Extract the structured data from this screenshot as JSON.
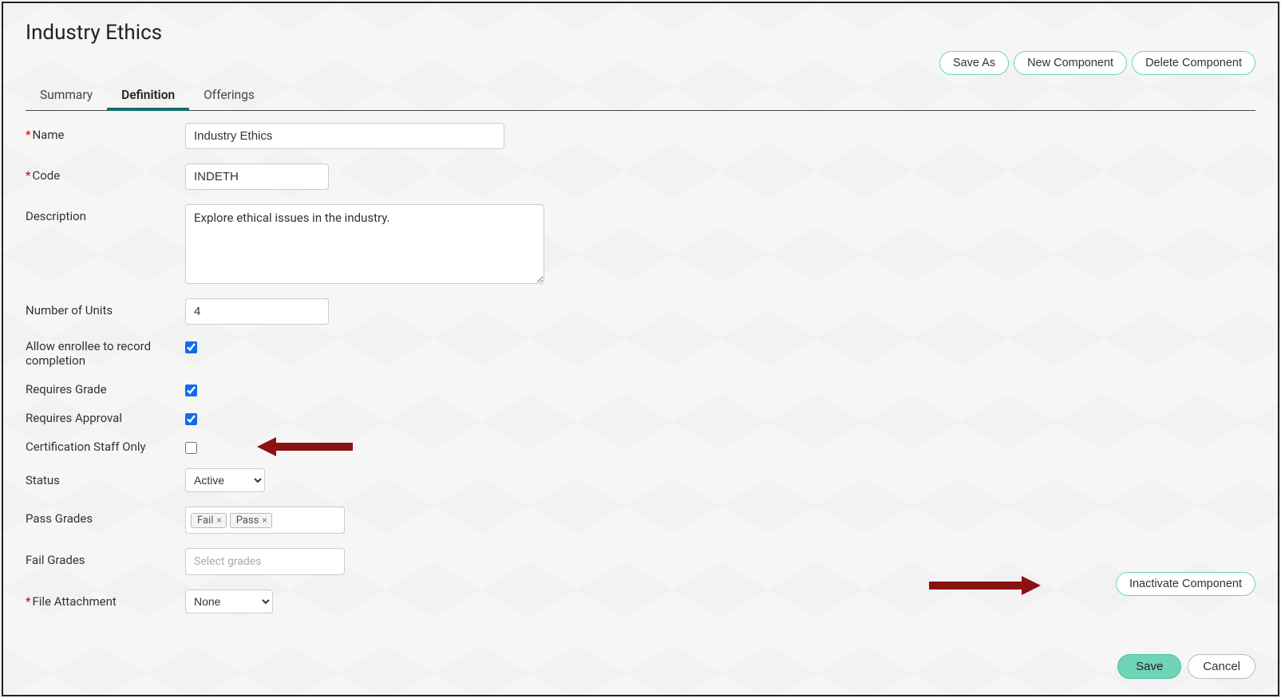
{
  "page": {
    "title": "Industry Ethics"
  },
  "top_actions": {
    "save_as": "Save As",
    "new_component": "New Component",
    "delete_component": "Delete Component"
  },
  "tabs": {
    "summary": "Summary",
    "definition": "Definition",
    "offerings": "Offerings"
  },
  "form": {
    "name_label": "Name",
    "name_value": "Industry Ethics",
    "code_label": "Code",
    "code_value": "INDETH",
    "description_label": "Description",
    "description_value": "Explore ethical issues in the industry.",
    "units_label": "Number of Units",
    "units_value": "4",
    "allow_enrollee_label": "Allow enrollee to record completion",
    "requires_grade_label": "Requires Grade",
    "requires_approval_label": "Requires Approval",
    "cert_staff_only_label": "Certification Staff Only",
    "status_label": "Status",
    "status_value": "Active",
    "pass_grades_label": "Pass Grades",
    "pass_grades": [
      "Fail",
      "Pass"
    ],
    "fail_grades_label": "Fail Grades",
    "fail_grades_placeholder": "Select grades",
    "file_attachment_label": "File Attachment",
    "file_attachment_value": "None"
  },
  "inactivate": {
    "label": "Inactivate Component"
  },
  "footer": {
    "save": "Save",
    "cancel": "Cancel"
  }
}
